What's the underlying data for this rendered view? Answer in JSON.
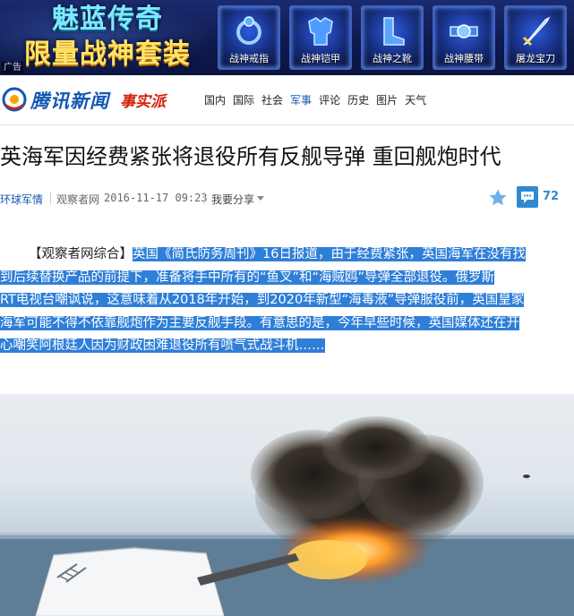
{
  "banner": {
    "line1": "魅蓝传奇",
    "line2": "限量战神套装",
    "ad_tag": "广告",
    "items": [
      {
        "label": "战神戒指",
        "icon": "ring-icon"
      },
      {
        "label": "战神铠甲",
        "icon": "armor-icon"
      },
      {
        "label": "战神之靴",
        "icon": "boots-icon"
      },
      {
        "label": "战神腰带",
        "icon": "belt-icon"
      },
      {
        "label": "屠龙宝刀",
        "icon": "sword-icon"
      }
    ]
  },
  "header": {
    "logo_text": "腾讯新闻",
    "sub_logo": "事实派",
    "nav": [
      {
        "label": "国内",
        "active": false
      },
      {
        "label": "国际",
        "active": false
      },
      {
        "label": "社会",
        "active": false
      },
      {
        "label": "军事",
        "active": true
      },
      {
        "label": "评论",
        "active": false
      },
      {
        "label": "历史",
        "active": false
      },
      {
        "label": "图片",
        "active": false
      },
      {
        "label": "天气",
        "active": false
      }
    ]
  },
  "article": {
    "title": "英海军因经费紧张将退役所有反舰导弹 重回舰炮时代",
    "source_tag": "环球军情",
    "origin": "观察者网",
    "time": "2016-11-17 09:23",
    "share_label": "我要分享",
    "comment_count": "72",
    "paragraph": {
      "lead": "【观察者网综合】",
      "lines": [
        "英国《简氏防务周刊》16日报道，由于经费紧张，英国海军在没有找",
        "到后续替换产品的前提下，准备将手中所有的“鱼叉”和“海贼鸥”导弹全部退役。俄罗斯",
        "RT电视台嘲讽说，这意味着从2018年开始，到2020年新型“海毒液”导弹服役前，英国皇家",
        "海军可能不得不依靠舰炮作为主要反舰手段。有意思的是，今年早些时候，英国媒体还在开",
        "心嘲笑阿根廷人因为财政困难退役所有喷气式战斗机……"
      ]
    }
  },
  "colors": {
    "brand_blue": "#1457b3",
    "selection": "#2f7fd8",
    "accent_red": "#d81e06",
    "comment_blue": "#2f88d0"
  }
}
